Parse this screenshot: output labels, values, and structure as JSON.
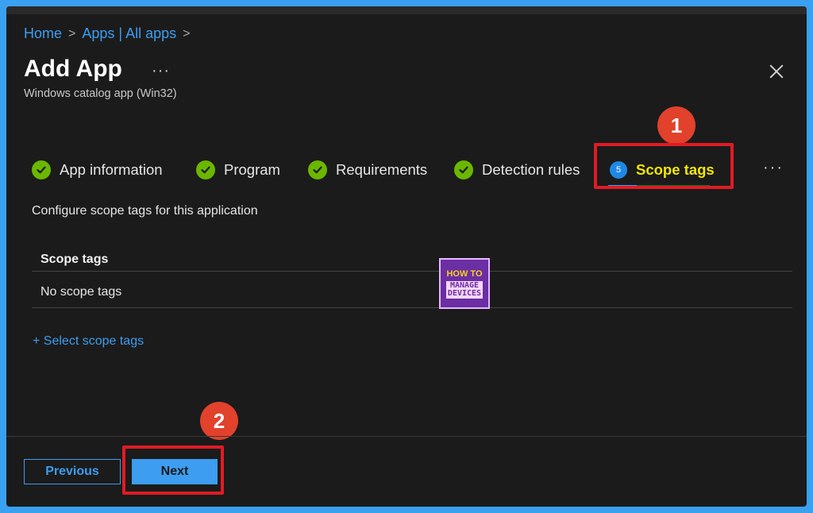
{
  "breadcrumb": {
    "home": "Home",
    "apps": "Apps | All apps",
    "sep": ">"
  },
  "header": {
    "title": "Add App",
    "more": "···",
    "subtitle": "Windows catalog app (Win32)"
  },
  "tabs": {
    "items": [
      {
        "label": "App information",
        "state": "completed"
      },
      {
        "label": "Program",
        "state": "completed"
      },
      {
        "label": "Requirements",
        "state": "completed"
      },
      {
        "label": "Detection rules",
        "state": "completed"
      },
      {
        "label": "Scope tags",
        "state": "active",
        "number": "5"
      }
    ],
    "more": "···"
  },
  "annotations": {
    "badge1": "1",
    "badge2": "2"
  },
  "content": {
    "description": "Configure scope tags for this application",
    "table_header": "Scope tags",
    "table_empty": "No scope tags",
    "select_link": "+ Select scope tags"
  },
  "watermark": {
    "line1": "HOW TO",
    "line2": "MANAGE",
    "line3": "DEVICES"
  },
  "footer": {
    "previous": "Previous",
    "next": "Next"
  },
  "colors": {
    "accent": "#3d9df0",
    "check": "#6bb700",
    "highlight": "#e01b24",
    "active_tab": "#f2e600"
  }
}
